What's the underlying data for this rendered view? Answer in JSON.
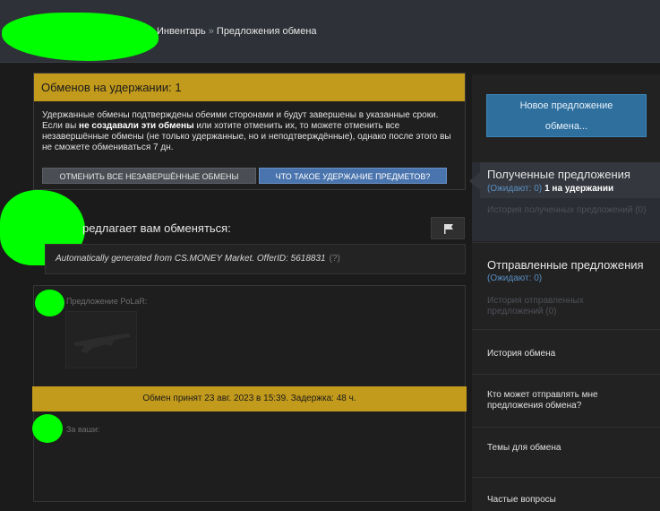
{
  "header": {
    "breadcrumb": {
      "inventory": "Инвентарь",
      "separator": "»",
      "offers": "Предложения обмена"
    }
  },
  "escrow": {
    "title": "Обменов на удержании: 1",
    "text_a": "Удержанные обмены подтверждены обеими сторонами и будут завершены в указанные сроки. Если вы ",
    "text_bold": "не создавали эти обмены",
    "text_b": " или хотите отменить их, то можете отменить все незавершённые обмены (не только удержанные, но и неподтверждённые), однако после этого вы не сможете обмениваться 7 дн.",
    "cancel_button": "ОТМЕНИТЬ ВСЕ НЕЗАВЕРШЁННЫЕ ОБМЕНЫ",
    "info_button": "ЧТО ТАКОЕ УДЕРЖАНИЕ ПРЕДМЕТОВ?"
  },
  "offer": {
    "title_partial": "редлагает вам обменяться:",
    "message": "Automatically generated from CS.MONEY Market. OfferID: 5618831",
    "message_help": "(?)",
    "their_label": "Предложение PoLaR:",
    "your_label": "За ваши:",
    "status": "Обмен принят 23 авг. 2023 в 15:39. Задержка: 48 ч."
  },
  "sidebar": {
    "new_offer_line1": "Новое предложение",
    "new_offer_line2": "обмена...",
    "received": {
      "title": "Полученные предложения",
      "pending": "(Ожидают: 0)",
      "on_hold": "1 на удержании",
      "history": "История полученных предложений (0)"
    },
    "sent": {
      "title": "Отправленные предложения",
      "pending": "(Ожидают: 0)",
      "history": "История отправленных предложений (0)"
    },
    "trade_history": "История обмена",
    "who_can_send": "Кто может отправлять мне предложения обмена?",
    "trade_topics": "Темы для обмена",
    "faq": "Частые вопросы"
  },
  "colors": {
    "gold": "#c29a1c",
    "blue_button": "#4a74ad",
    "new_offer": "#2f6f9e",
    "redaction": "#00ff00"
  }
}
